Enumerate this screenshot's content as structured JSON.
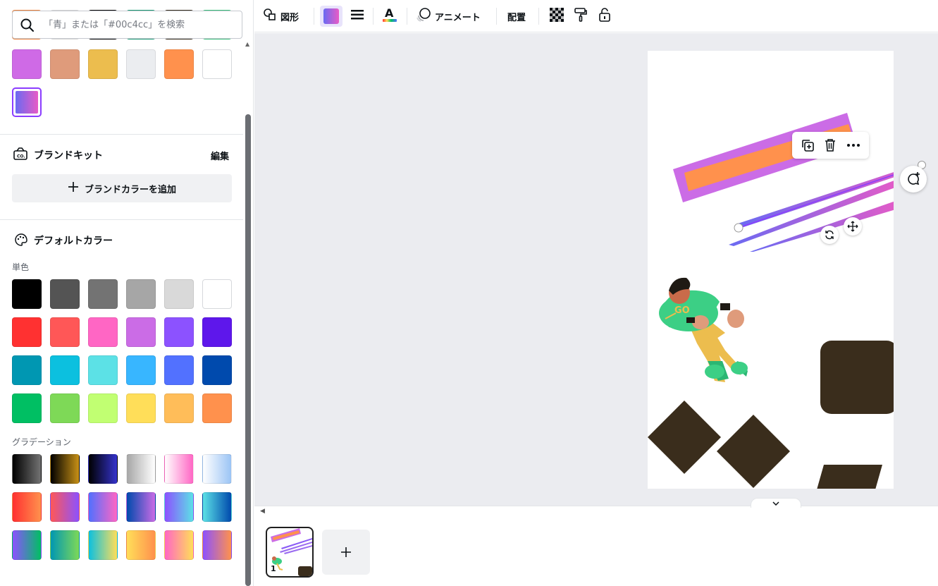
{
  "search": {
    "placeholder": "「青」または「#00c4cc」を検索"
  },
  "recent_colors": {
    "row_partial": [
      "#ff8a3d",
      "#e7e7e7",
      "#000000",
      "#1aa57d",
      "#3a2d1c",
      "#3ccf85"
    ],
    "row1": [
      "#cf6ae6",
      "#df9b7b",
      "#ecbd4e",
      "#ebedf0",
      "#ff914d",
      "#ffffff"
    ],
    "selected_gradient": [
      "#6a6af2",
      "#e85bc6"
    ]
  },
  "brand_kit": {
    "title": "ブランドキット",
    "edit_label": "編集",
    "add_label": "ブランドカラーを追加"
  },
  "default_colors": {
    "title": "デフォルトカラー",
    "solid_label": "単色",
    "solid": [
      [
        "#000000",
        "#545454",
        "#737373",
        "#a6a6a6",
        "#d9d9d9",
        "#ffffff"
      ],
      [
        "#ff3131",
        "#ff5757",
        "#ff66c4",
        "#cb6ce6",
        "#8c52ff",
        "#5e17eb"
      ],
      [
        "#0097b2",
        "#0cc0df",
        "#5ce1e6",
        "#38b6ff",
        "#5271ff",
        "#004aad"
      ],
      [
        "#00bf63",
        "#7ed957",
        "#c1ff72",
        "#ffde59",
        "#ffbd59",
        "#ff914d"
      ]
    ],
    "gradient_label": "グラデーション",
    "gradients": [
      [
        [
          "#000000",
          "#737373"
        ],
        [
          "#000000",
          "#c89116"
        ],
        [
          "#000000",
          "#3533cd"
        ],
        [
          "#a6a6a6",
          "#ffffff"
        ],
        [
          "#ffffff",
          "#ff66c4"
        ],
        [
          "#ffffff",
          "#9bc4f5"
        ]
      ],
      [
        [
          "#ff3131",
          "#ff914d"
        ],
        [
          "#ff5757",
          "#8c52ff"
        ],
        [
          "#5170ff",
          "#ff66c4"
        ],
        [
          "#004aad",
          "#cb6ce6"
        ],
        [
          "#8c52ff",
          "#5ce1e6"
        ],
        [
          "#5ce1e6",
          "#004aad"
        ]
      ],
      [
        [
          "#8c52ff",
          "#00bf63"
        ],
        [
          "#0097b2",
          "#7ed957"
        ],
        [
          "#0cc0df",
          "#ffde59"
        ],
        [
          "#ffde59",
          "#ff914d"
        ],
        [
          "#ff66c4",
          "#ffde59"
        ],
        [
          "#8c52ff",
          "#ff914d"
        ]
      ]
    ]
  },
  "toolbar": {
    "shape_label": "図形",
    "animate_label": "アニメート",
    "position_label": "配置",
    "fill_gradient": [
      "#6a6af2",
      "#e85bc6"
    ]
  },
  "canvas": {
    "page_number": "1"
  },
  "icons": {
    "search": "search-icon",
    "brand_kit": "brand-kit-icon",
    "palette": "palette-icon",
    "plus": "plus-icon",
    "shape": "shapes-icon",
    "border": "border-style-icon",
    "text_color": "text-color-icon",
    "animate": "animate-icon",
    "transparency": "transparency-icon",
    "paint": "paint-roller-icon",
    "lock": "lock-icon",
    "duplicate": "duplicate-icon",
    "delete": "trash-icon",
    "more": "more-icon",
    "rotate": "rotate-icon",
    "move": "move-icon",
    "comment": "add-comment-icon"
  }
}
